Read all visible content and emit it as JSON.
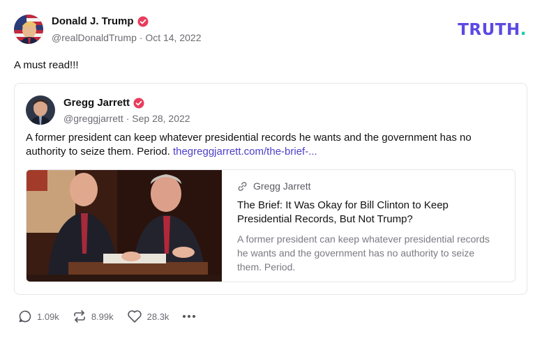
{
  "post": {
    "author_name": "Donald J. Trump",
    "author_handle": "@realDonaldTrump",
    "separator": "·",
    "date": "Oct 14, 2022",
    "text": "A must read!!!"
  },
  "logo": {
    "word": "TRUTH",
    "dot": "."
  },
  "quote": {
    "author_name": "Gregg Jarrett",
    "author_handle": "@greggjarrett",
    "separator": "·",
    "date": "Sep 28, 2022",
    "text": "A former president can keep whatever presidential records he wants and the government has no authority to seize them.  Period.",
    "link_text": "thegreggjarrett.com/the-brief-..."
  },
  "card": {
    "source": "Gregg Jarrett",
    "title": "The Brief: It Was Okay for Bill Clinton to Keep Presidential Records, But Not Trump?",
    "description": "A former president can keep whatever presidential records he wants and the government has no authority to seize them.  Period."
  },
  "actions": {
    "replies": "1.09k",
    "retruths": "8.99k",
    "likes": "28.3k"
  },
  "colors": {
    "brand": "#5b4ae3",
    "brand_dot": "#0fd0a8",
    "verified": "#e83d5c",
    "link": "#4a3fc9"
  }
}
